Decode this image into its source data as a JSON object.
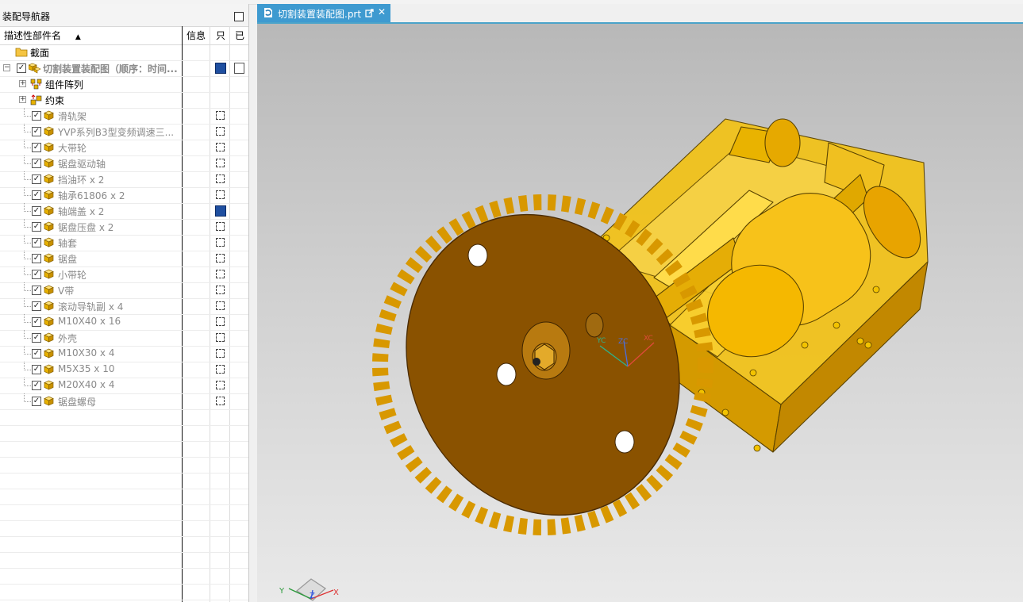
{
  "navigator": {
    "title": "装配导航器",
    "columns": {
      "name": "描述性部件名",
      "info": "信息",
      "readonly": "只",
      "modified": "已"
    },
    "sort_indicator": "▲",
    "rows": [
      {
        "label": "截面",
        "style": "normal",
        "icon": "folder-icon"
      },
      {
        "label": "切割装置装配图（顺序：时间...",
        "style": "bold",
        "icon": "assembly-icon"
      },
      {
        "label": "组件阵列",
        "style": "normal",
        "icon": "component-array-icon"
      },
      {
        "label": "约束",
        "style": "normal",
        "icon": "constraint-icon"
      },
      {
        "label": "滑轨架",
        "style": "dim",
        "icon": "part-cube-icon"
      },
      {
        "label": "YVP系列B3型变频调速三...",
        "style": "dim",
        "icon": "part-cube-icon"
      },
      {
        "label": "大带轮",
        "style": "dim",
        "icon": "part-cube-icon"
      },
      {
        "label": "锯盘驱动轴",
        "style": "dim",
        "icon": "part-cube-icon"
      },
      {
        "label": "挡油环 x 2",
        "style": "dim",
        "icon": "part-cube-icon"
      },
      {
        "label": "轴承61806 x 2",
        "style": "dim",
        "icon": "part-cube-icon"
      },
      {
        "label": "轴端盖 x 2",
        "style": "dim",
        "icon": "part-cube-icon"
      },
      {
        "label": "锯盘压盘 x 2",
        "style": "dim",
        "icon": "part-cube-icon"
      },
      {
        "label": "轴套",
        "style": "dim",
        "icon": "part-cube-icon"
      },
      {
        "label": "锯盘",
        "style": "dim",
        "icon": "part-cube-icon"
      },
      {
        "label": "小带轮",
        "style": "dim",
        "icon": "part-cube-icon"
      },
      {
        "label": "V带",
        "style": "dim",
        "icon": "part-cube-icon"
      },
      {
        "label": "滚动导轨副 x 4",
        "style": "dim",
        "icon": "part-cube-icon"
      },
      {
        "label": "M10X40 x 16",
        "style": "dim",
        "icon": "part-cube-icon"
      },
      {
        "label": "外壳",
        "style": "dim",
        "icon": "part-cube-icon"
      },
      {
        "label": "M10X30 x 4",
        "style": "dim",
        "icon": "part-cube-icon"
      },
      {
        "label": "M5X35 x 10",
        "style": "dim",
        "icon": "part-cube-icon"
      },
      {
        "label": "M20X40 x 4",
        "style": "dim",
        "icon": "part-cube-icon"
      },
      {
        "label": "锯盘螺母",
        "style": "dim",
        "icon": "part-cube-icon"
      }
    ]
  },
  "tab": {
    "title": "切割装置装配图.prt",
    "close_glyph": "✕"
  },
  "triad": {
    "x": "X",
    "y": "Y",
    "z": "Z",
    "zc": "ZC",
    "xc": "XC",
    "yc": "YC"
  },
  "colors": {
    "part": "#f2b705",
    "saw": "#8a5200",
    "tab": "#3e9ad0"
  }
}
